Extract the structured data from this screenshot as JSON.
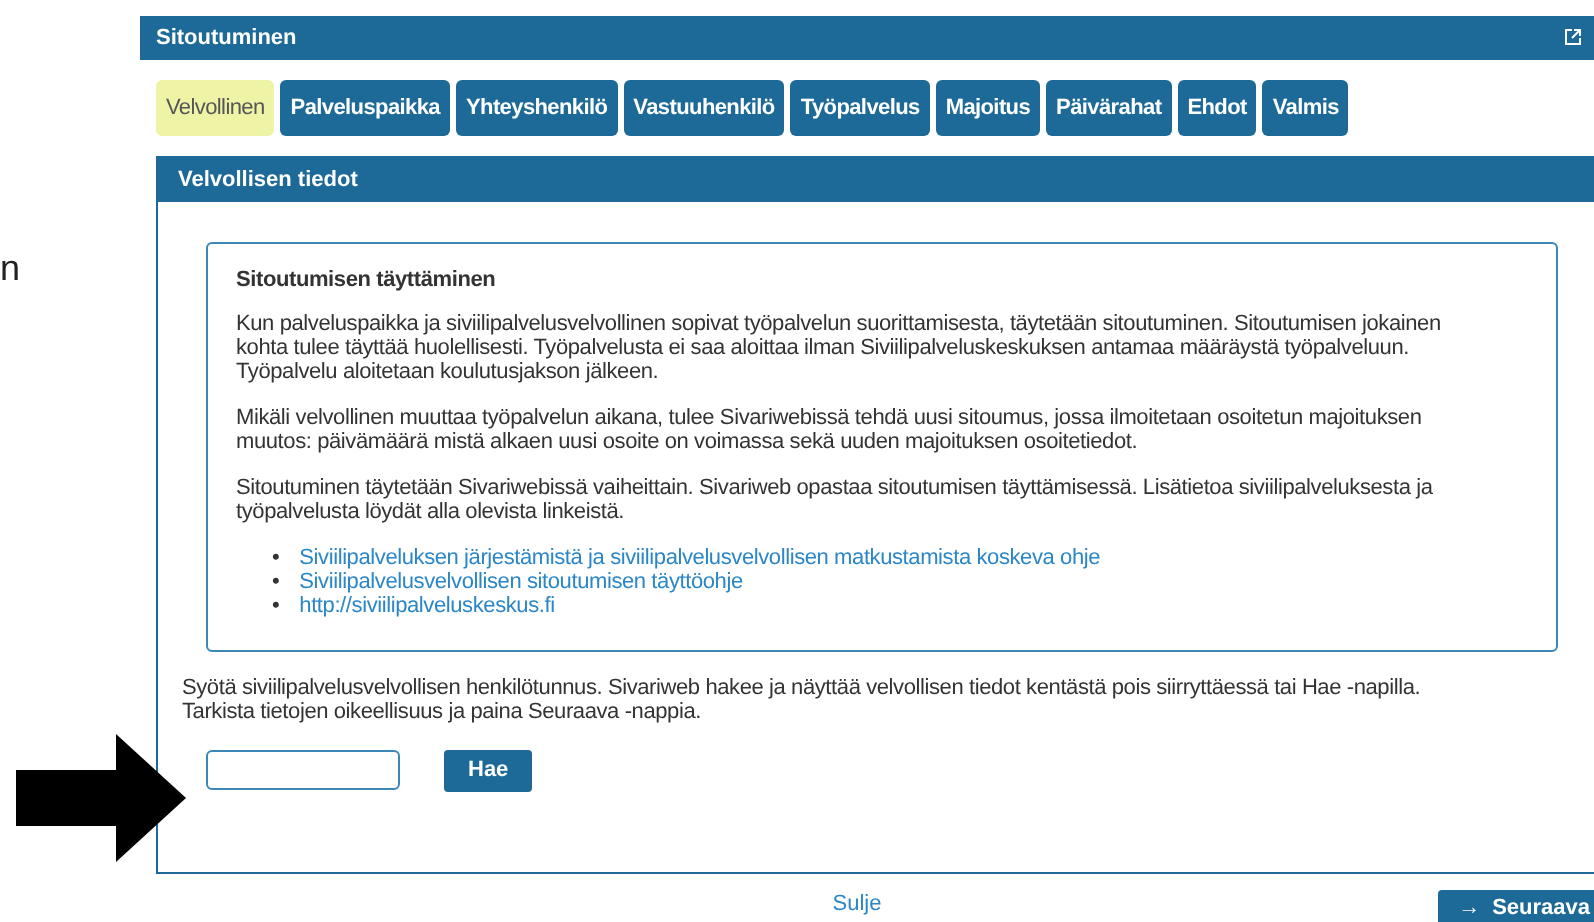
{
  "slide_fragment": "n",
  "window": {
    "title": "Sitoutuminen"
  },
  "tabs": [
    {
      "label": "Velvollinen",
      "selected": true
    },
    {
      "label": "Palveluspaikka",
      "selected": false
    },
    {
      "label": "Yhteyshenkilö",
      "selected": false
    },
    {
      "label": "Vastuuhenkilö",
      "selected": false
    },
    {
      "label": "Työpalvelus",
      "selected": false
    },
    {
      "label": "Majoitus",
      "selected": false
    },
    {
      "label": "Päivärahat",
      "selected": false
    },
    {
      "label": "Ehdot",
      "selected": false
    },
    {
      "label": "Valmis",
      "selected": false
    }
  ],
  "panel": {
    "title": "Velvollisen tiedot",
    "info": {
      "heading": "Sitoutumisen täyttäminen",
      "paragraphs": [
        "Kun palveluspaikka ja siviilipalvelusvelvollinen sopivat työpalvelun suorittamisesta, täytetään sitoutuminen. Sitoutumisen jokainen kohta tulee täyttää huolellisesti. Työpalvelusta ei saa aloittaa ilman Siviilipalveluskeskuksen antamaa määräystä työpalveluun. Työpalvelu aloitetaan koulutusjakson jälkeen.",
        "Mikäli velvollinen muuttaa työpalvelun aikana, tulee Sivariwebissä tehdä uusi sitoumus, jossa ilmoitetaan osoitetun majoituksen muutos: päivämäärä mistä alkaen uusi osoite on voimassa sekä uuden majoituksen osoitetiedot.",
        "Sitoutuminen täytetään Sivariwebissä vaiheittain. Sivariweb opastaa sitoutumisen täyttämisessä. Lisätietoa siviilipalveluksesta ja työpalvelusta löydät alla olevista linkeistä."
      ],
      "links": [
        {
          "bullet": "•",
          "text": "Siviilipalveluksen järjestämistä ja siviilipalvelusvelvollisen matkustamista koskeva ohje"
        },
        {
          "bullet": "•",
          "text": "Siviilipalvelusvelvollisen sitoutumisen täyttöohje"
        },
        {
          "bullet": "•",
          "text": "http://siviilipalveluskeskus.fi"
        }
      ]
    },
    "instructions": [
      "Syötä siviilipalvelusvelvollisen henkilötunnus. Sivariweb hakee ja näyttää velvollisen tiedot kentästä pois siirryttäessä tai Hae -napilla.",
      "Tarkista tietojen oikeellisuus ja paina Seuraava -nappia."
    ],
    "search_button": "Hae"
  },
  "footer": {
    "close_link": "Sulje",
    "next_button": {
      "icon": "→",
      "label": "Seuraava"
    }
  }
}
